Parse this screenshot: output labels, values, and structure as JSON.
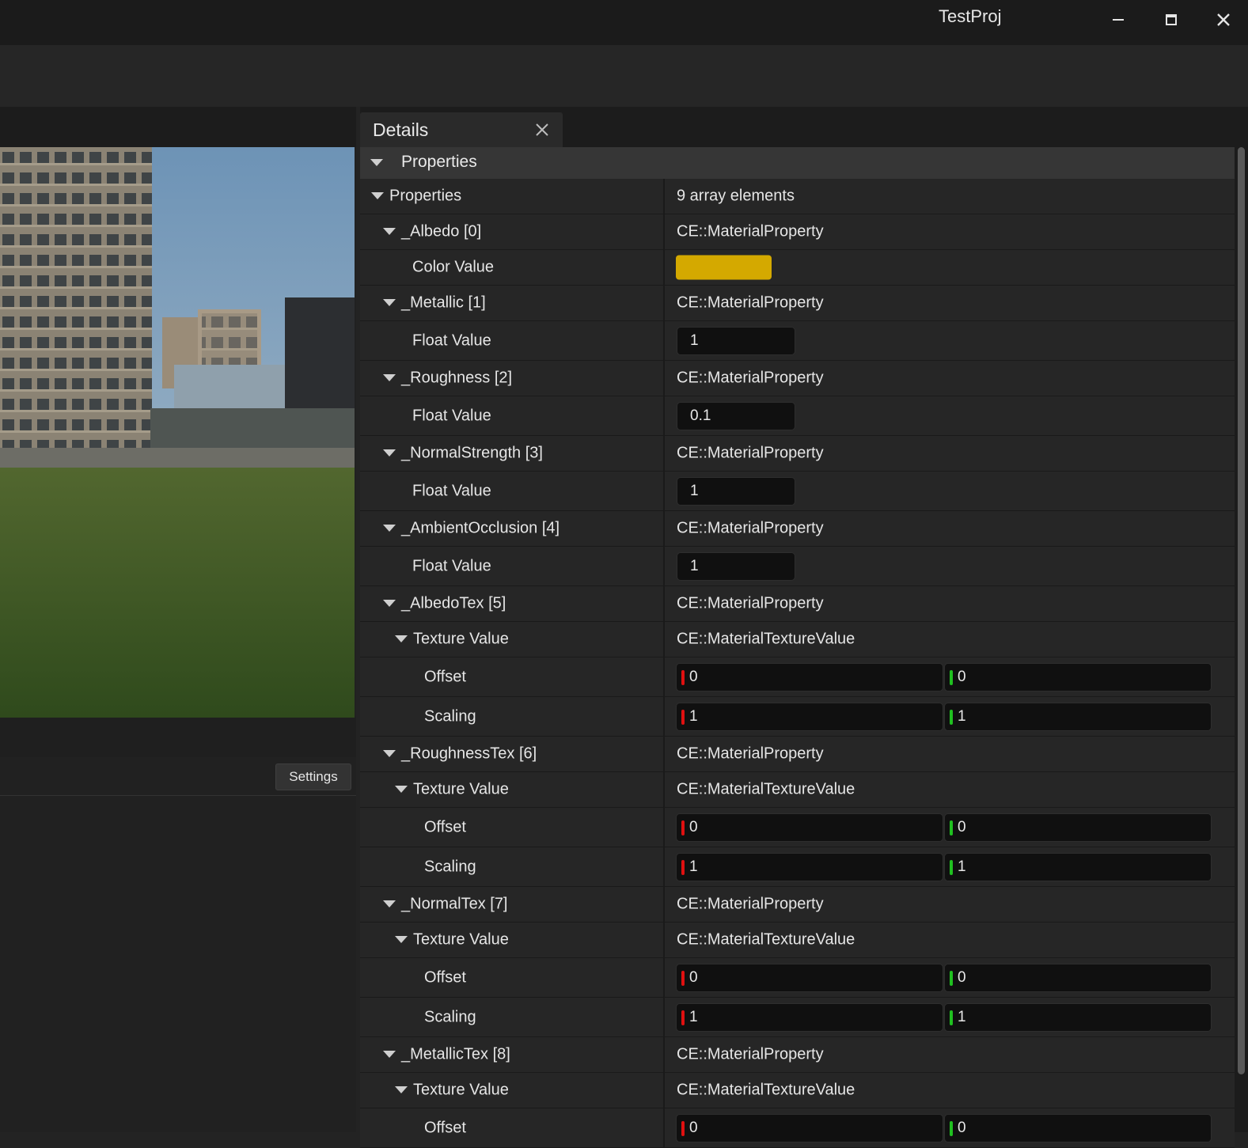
{
  "window": {
    "title": "TestProj",
    "icons": [
      "minimize-icon",
      "maximize-icon",
      "close-icon"
    ]
  },
  "left_panel": {
    "settings_label": "Settings"
  },
  "details": {
    "tab_label": "Details",
    "section_label": "Properties",
    "rows": [
      {
        "name": "Properties",
        "indent": 0,
        "expand": true,
        "kind": "text",
        "value": "9 array elements"
      },
      {
        "name": "_Albedo [0]",
        "indent": 1,
        "expand": true,
        "kind": "text",
        "value": "CE::MaterialProperty"
      },
      {
        "name": "Color Value",
        "indent": 2,
        "expand": false,
        "kind": "color",
        "color": "#d4a900"
      },
      {
        "name": "_Metallic [1]",
        "indent": 1,
        "expand": true,
        "kind": "text",
        "value": "CE::MaterialProperty"
      },
      {
        "name": "Float Value",
        "indent": 2,
        "expand": false,
        "kind": "float",
        "value": "1"
      },
      {
        "name": "_Roughness [2]",
        "indent": 1,
        "expand": true,
        "kind": "text",
        "value": "CE::MaterialProperty"
      },
      {
        "name": "Float Value",
        "indent": 2,
        "expand": false,
        "kind": "float",
        "value": "0.1"
      },
      {
        "name": "_NormalStrength [3]",
        "indent": 1,
        "expand": true,
        "kind": "text",
        "value": "CE::MaterialProperty"
      },
      {
        "name": "Float Value",
        "indent": 2,
        "expand": false,
        "kind": "float",
        "value": "1"
      },
      {
        "name": "_AmbientOcclusion [4]",
        "indent": 1,
        "expand": true,
        "kind": "text",
        "value": "CE::MaterialProperty"
      },
      {
        "name": "Float Value",
        "indent": 2,
        "expand": false,
        "kind": "float",
        "value": "1"
      },
      {
        "name": "_AlbedoTex [5]",
        "indent": 1,
        "expand": true,
        "kind": "text",
        "value": "CE::MaterialProperty"
      },
      {
        "name": "Texture Value",
        "indent": 2,
        "expand": true,
        "kind": "text",
        "value": "CE::MaterialTextureValue"
      },
      {
        "name": "Offset",
        "indent": 3,
        "expand": false,
        "kind": "vec2",
        "x": "0",
        "y": "0"
      },
      {
        "name": "Scaling",
        "indent": 3,
        "expand": false,
        "kind": "vec2",
        "x": "1",
        "y": "1"
      },
      {
        "name": "_RoughnessTex [6]",
        "indent": 1,
        "expand": true,
        "kind": "text",
        "value": "CE::MaterialProperty"
      },
      {
        "name": "Texture Value",
        "indent": 2,
        "expand": true,
        "kind": "text",
        "value": "CE::MaterialTextureValue"
      },
      {
        "name": "Offset",
        "indent": 3,
        "expand": false,
        "kind": "vec2",
        "x": "0",
        "y": "0"
      },
      {
        "name": "Scaling",
        "indent": 3,
        "expand": false,
        "kind": "vec2",
        "x": "1",
        "y": "1"
      },
      {
        "name": "_NormalTex [7]",
        "indent": 1,
        "expand": true,
        "kind": "text",
        "value": "CE::MaterialProperty"
      },
      {
        "name": "Texture Value",
        "indent": 2,
        "expand": true,
        "kind": "text",
        "value": "CE::MaterialTextureValue"
      },
      {
        "name": "Offset",
        "indent": 3,
        "expand": false,
        "kind": "vec2",
        "x": "0",
        "y": "0"
      },
      {
        "name": "Scaling",
        "indent": 3,
        "expand": false,
        "kind": "vec2",
        "x": "1",
        "y": "1"
      },
      {
        "name": "_MetallicTex [8]",
        "indent": 1,
        "expand": true,
        "kind": "text",
        "value": "CE::MaterialProperty"
      },
      {
        "name": "Texture Value",
        "indent": 2,
        "expand": true,
        "kind": "text",
        "value": "CE::MaterialTextureValue"
      },
      {
        "name": "Offset",
        "indent": 3,
        "expand": false,
        "kind": "vec2",
        "x": "0",
        "y": "0"
      }
    ]
  },
  "colors": {
    "x_axis": "#e01010",
    "y_axis": "#20c020",
    "albedo": "#d4a900"
  }
}
